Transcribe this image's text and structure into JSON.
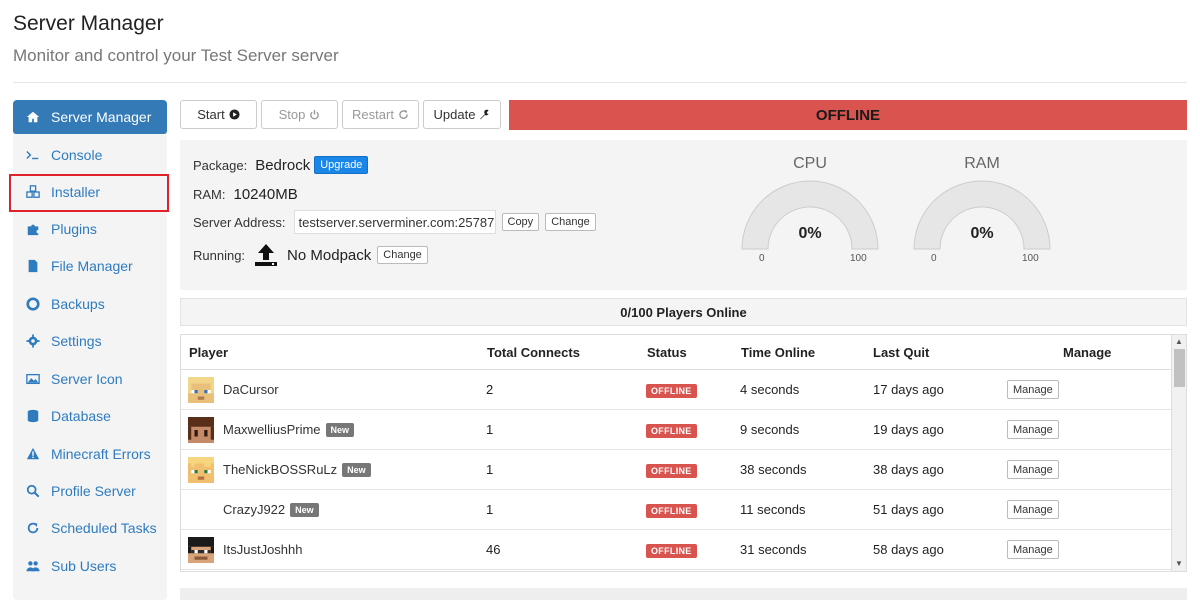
{
  "header": {
    "title": "Server Manager",
    "subtitle": "Monitor and control your Test Server server"
  },
  "sidebar": {
    "items": [
      {
        "label": "Server Manager",
        "icon": "home-icon"
      },
      {
        "label": "Console",
        "icon": "terminal-icon"
      },
      {
        "label": "Installer",
        "icon": "cubes-icon"
      },
      {
        "label": "Plugins",
        "icon": "puzzle-icon"
      },
      {
        "label": "File Manager",
        "icon": "file-icon"
      },
      {
        "label": "Backups",
        "icon": "life-ring-icon"
      },
      {
        "label": "Settings",
        "icon": "gear-icon"
      },
      {
        "label": "Server Icon",
        "icon": "image-icon"
      },
      {
        "label": "Database",
        "icon": "database-icon"
      },
      {
        "label": "Minecraft Errors",
        "icon": "warning-icon"
      },
      {
        "label": "Profile Server",
        "icon": "search-icon"
      },
      {
        "label": "Scheduled Tasks",
        "icon": "refresh-icon"
      },
      {
        "label": "Sub Users",
        "icon": "users-icon"
      }
    ],
    "active": "Server Manager",
    "highlighted": "Installer"
  },
  "toolbar": {
    "start_label": "Start",
    "stop_label": "Stop",
    "restart_label": "Restart",
    "update_label": "Update",
    "status": "OFFLINE",
    "status_color": "#d9534f"
  },
  "info": {
    "package_label": "Package:",
    "package_value": "Bedrock",
    "upgrade_label": "Upgrade",
    "ram_label": "RAM:",
    "ram_value": "10240MB",
    "address_label": "Server Address:",
    "address_value": "testserver.serverminer.com:25787",
    "copy_label": "Copy",
    "change_label": "Change",
    "running_label": "Running:",
    "running_value": "No Modpack",
    "running_change_label": "Change"
  },
  "gauges": {
    "cpu": {
      "label": "CPU",
      "value": "0%",
      "min": "0",
      "max": "100"
    },
    "ram": {
      "label": "RAM",
      "value": "0%",
      "min": "0",
      "max": "100"
    }
  },
  "players": {
    "header": "0/100 Players Online",
    "columns": [
      "Player",
      "Total Connects",
      "Status",
      "Time Online",
      "Last Quit",
      "Manage"
    ],
    "rows": [
      {
        "name": "DaCursor",
        "is_new": false,
        "badge": "",
        "connects": "2",
        "status": "OFFLINE",
        "time_online": "4 seconds",
        "last_quit": "17 days ago",
        "manage": "Manage",
        "avatar": "blond"
      },
      {
        "name": "MaxwelliusPrime",
        "is_new": true,
        "badge": "New",
        "connects": "1",
        "status": "OFFLINE",
        "time_online": "9 seconds",
        "last_quit": "19 days ago",
        "manage": "Manage",
        "avatar": "brown"
      },
      {
        "name": "TheNickBOSSRuLz",
        "is_new": true,
        "badge": "New",
        "connects": "1",
        "status": "OFFLINE",
        "time_online": "38 seconds",
        "last_quit": "38 days ago",
        "manage": "Manage",
        "avatar": "blond2"
      },
      {
        "name": "CrazyJ922",
        "is_new": true,
        "badge": "New",
        "connects": "1",
        "status": "OFFLINE",
        "time_online": "11 seconds",
        "last_quit": "51 days ago",
        "manage": "Manage",
        "avatar": "none"
      },
      {
        "name": "ItsJustJoshhh",
        "is_new": false,
        "badge": "",
        "connects": "46",
        "status": "OFFLINE",
        "time_online": "31 seconds",
        "last_quit": "58 days ago",
        "manage": "Manage",
        "avatar": "dark"
      }
    ]
  }
}
